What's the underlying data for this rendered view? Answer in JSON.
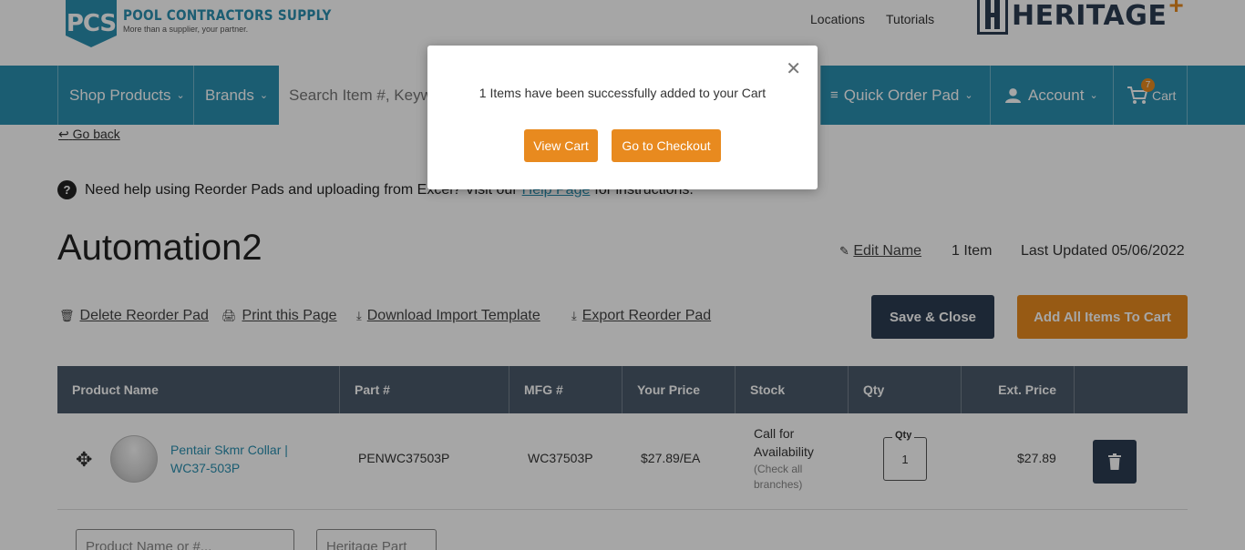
{
  "header": {
    "pcs_logo_initials": "PCS",
    "pcs_logo_name": "POOL CONTRACTORS SUPPLY",
    "pcs_logo_tagline": "More than a supplier, your partner.",
    "links": [
      "Locations",
      "Tutorials"
    ],
    "heritage_logo_word": "HERITAGE",
    "heritage_logo_plus": "+"
  },
  "nav": {
    "shop_products": "Shop Products",
    "brands": "Brands",
    "search_placeholder": "Search Item #, Keyword",
    "quick_order_pad": "Quick Order Pad",
    "account": "Account",
    "cart_label": "Cart",
    "cart_count": "7"
  },
  "main": {
    "go_back": "Go back",
    "help_text_before": "Need help using Reorder Pads and uploading from Excel? Visit our",
    "help_link": "Help Page",
    "help_text_after": "for instructions.",
    "title": "Automation2",
    "edit_name": "Edit Name",
    "item_count": "1 Item",
    "last_updated": "Last Updated 05/06/2022",
    "actions": {
      "delete": "Delete Reorder Pad",
      "print": "Print this Page",
      "download": "Download Import Template",
      "export": "Export Reorder Pad"
    },
    "save_close": "Save & Close",
    "add_all": "Add All Items To Cart"
  },
  "table": {
    "headers": [
      "Product Name",
      "Part #",
      "MFG #",
      "Your Price",
      "Stock",
      "Qty",
      "Ext. Price"
    ],
    "rows": [
      {
        "product_name": "Pentair Skmr Collar | WC37-503P",
        "part": "PENWC37503P",
        "mfg": "WC37503P",
        "price": "$27.89/EA",
        "stock_main": "Call for Availability",
        "stock_sub": "(Check all branches)",
        "qty_label": "Qty",
        "qty": "1",
        "ext_price": "$27.89"
      }
    ],
    "add_row": {
      "product_placeholder": "Product Name or #...",
      "part_placeholder": "Heritage Part #..."
    }
  },
  "modal": {
    "message": "1 Items have been successfully added to your Cart",
    "view_cart": "View Cart",
    "checkout": "Go to Checkout"
  },
  "colors": {
    "nav_blue": "#2a8fb0",
    "navy": "#2b3d52",
    "orange": "#e88a1f"
  }
}
